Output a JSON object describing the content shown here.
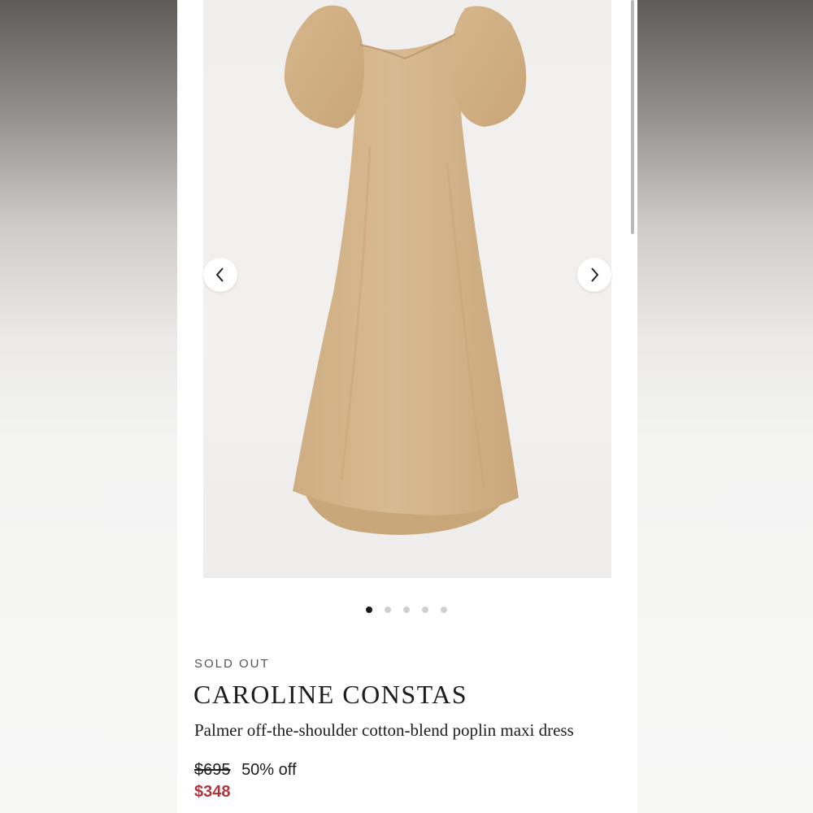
{
  "product": {
    "status": "SOLD OUT",
    "brand": "CAROLINE CONSTAS",
    "title": "Palmer off-the-shoulder cotton-blend poplin maxi dress",
    "original_price": "$695",
    "discount": "50% off",
    "sale_price": "$348"
  },
  "gallery": {
    "image_count": 5,
    "active_index": 0,
    "prev_icon": "chevron-left-icon",
    "next_icon": "chevron-right-icon"
  },
  "colors": {
    "sale_price": "#b0363e",
    "dress": "#d4b48a",
    "active_dot": "#1a1a1a",
    "inactive_dot": "#d0d0d0"
  }
}
